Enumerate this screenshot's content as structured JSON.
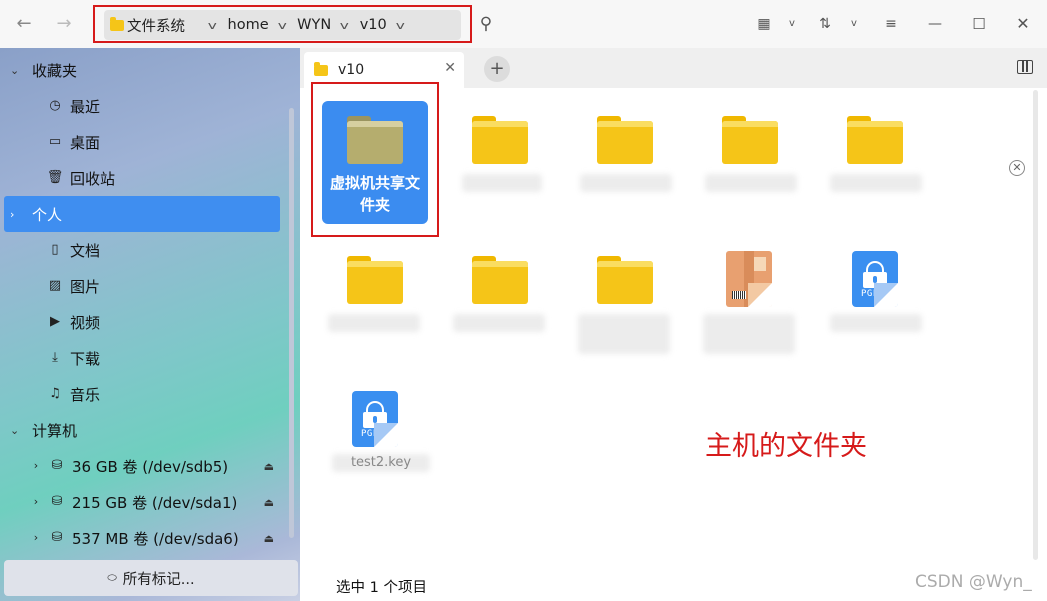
{
  "titlebar": {
    "path": [
      "文件系统",
      "home",
      "WYN",
      "v10"
    ]
  },
  "sidebar": {
    "sections": [
      {
        "label": "收藏夹",
        "items": [
          {
            "icon": "clock-icon",
            "label": "最近"
          },
          {
            "icon": "desktop-icon",
            "label": "桌面"
          },
          {
            "icon": "trash-icon",
            "label": "回收站"
          }
        ]
      },
      {
        "label": "个人",
        "items": [
          {
            "icon": "document-icon",
            "label": "文档"
          },
          {
            "icon": "image-icon",
            "label": "图片"
          },
          {
            "icon": "video-icon",
            "label": "视频"
          },
          {
            "icon": "download-icon",
            "label": "下载"
          },
          {
            "icon": "music-icon",
            "label": "音乐"
          }
        ]
      },
      {
        "label": "计算机",
        "items": [
          {
            "label": "36 GB 卷 (/dev/sdb5)"
          },
          {
            "label": "215 GB 卷 (/dev/sda1)"
          },
          {
            "label": "537 MB 卷 (/dev/sda6)"
          }
        ]
      }
    ],
    "tags_button": "所有标记..."
  },
  "tabs": [
    {
      "label": "v10"
    }
  ],
  "files": {
    "selected": {
      "label_line1": "虚拟机共享文",
      "label_line2": "件夹"
    },
    "items": [
      {
        "type": "folder"
      },
      {
        "type": "folder"
      },
      {
        "type": "folder"
      },
      {
        "type": "folder"
      },
      {
        "type": "folder"
      },
      {
        "type": "folder"
      },
      {
        "type": "folder"
      },
      {
        "type": "archive"
      },
      {
        "type": "key"
      }
    ],
    "last": {
      "type": "key",
      "label": "test2.key"
    }
  },
  "annotation": "主机的文件夹",
  "status": "选中 1 个项目",
  "watermark": "CSDN @Wyn_",
  "colors": {
    "accent": "#3f8ef0",
    "annotation": "#d61a1a",
    "folder": "#f5c518"
  }
}
